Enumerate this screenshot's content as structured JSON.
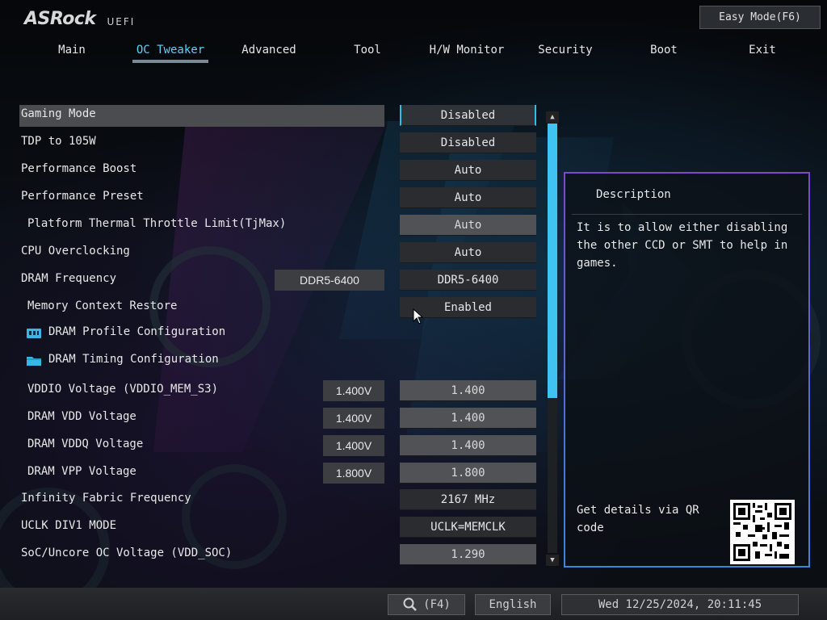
{
  "header": {
    "logo_main": "ASRock",
    "logo_sub": "UEFI",
    "easy_mode": "Easy Mode(F6)"
  },
  "tabs": [
    {
      "label": "Main",
      "active": false
    },
    {
      "label": "OC Tweaker",
      "active": true
    },
    {
      "label": "Advanced",
      "active": false
    },
    {
      "label": "Tool",
      "active": false
    },
    {
      "label": "H/W Monitor",
      "active": false
    },
    {
      "label": "Security",
      "active": false
    },
    {
      "label": "Boot",
      "active": false
    },
    {
      "label": "Exit",
      "active": false
    }
  ],
  "settings": [
    {
      "label": "Gaming Mode",
      "value": "Disabled"
    },
    {
      "label": "TDP to 105W",
      "value": "Disabled"
    },
    {
      "label": "Performance Boost",
      "value": "Auto"
    },
    {
      "label": "Performance Preset",
      "value": "Auto"
    },
    {
      "label": "Platform Thermal Throttle Limit(TjMax)",
      "value": "Auto"
    },
    {
      "label": "CPU Overclocking",
      "value": "Auto"
    },
    {
      "label": "DRAM Frequency",
      "current": "DDR5-6400",
      "value": "DDR5-6400"
    },
    {
      "label": "Memory Context Restore",
      "value": "Enabled"
    },
    {
      "label": "DRAM Profile Configuration"
    },
    {
      "label": "DRAM Timing Configuration"
    },
    {
      "label": "VDDIO Voltage (VDDIO_MEM_S3)",
      "current": "1.400V",
      "value": "1.400"
    },
    {
      "label": "DRAM VDD Voltage",
      "current": "1.400V",
      "value": "1.400"
    },
    {
      "label": "DRAM VDDQ Voltage",
      "current": "1.400V",
      "value": "1.400"
    },
    {
      "label": "DRAM VPP Voltage",
      "current": "1.800V",
      "value": "1.800"
    },
    {
      "label": "Infinity Fabric Frequency",
      "value": "2167 MHz"
    },
    {
      "label": "UCLK DIV1 MODE",
      "value": "UCLK=MEMCLK"
    },
    {
      "label": "SoC/Uncore OC Voltage (VDD_SOC)",
      "value": "1.290"
    }
  ],
  "description": {
    "title": "Description",
    "text": "It is to allow either disabling the other CCD or SMT to help in games.",
    "qr_text": "Get details via QR code"
  },
  "footer": {
    "search_label": "(F4)",
    "language": "English",
    "datetime": "Wed 12/25/2024, 20:11:45"
  },
  "scrollbar": {
    "position_fraction": 0.0,
    "visible_fraction": 0.64
  },
  "colors": {
    "accent": "#3fc3f0",
    "active_tab": "#5fd0f5",
    "panel_border_top": "#7b49c9",
    "panel_border_bottom": "#3b86d8"
  }
}
